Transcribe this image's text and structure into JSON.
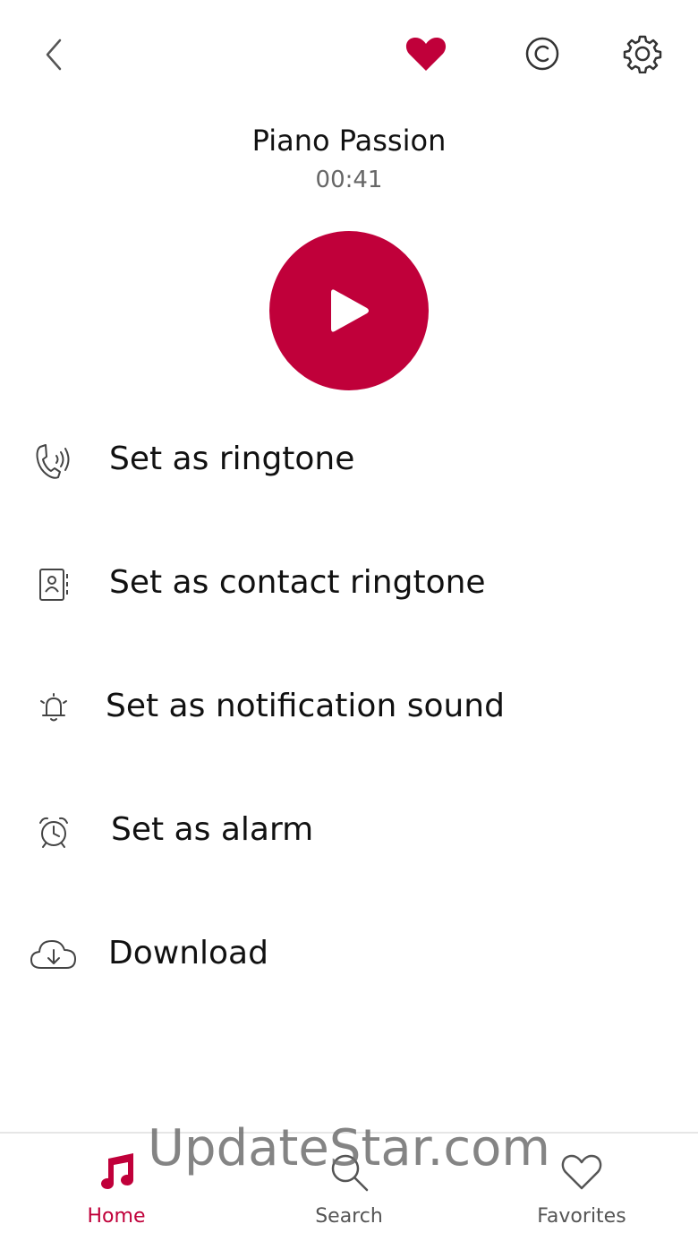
{
  "colors": {
    "accent": "#c0003a",
    "text": "#111111",
    "muted": "#666666"
  },
  "header": {
    "back_icon": "chevron-left-icon",
    "favorite_icon": "heart-filled-icon",
    "copyright_icon": "copyright-icon",
    "settings_icon": "gear-icon"
  },
  "track": {
    "title": "Piano Passion",
    "duration": "00:41"
  },
  "player": {
    "play_icon": "play-icon"
  },
  "actions": [
    {
      "label": "Set as ringtone",
      "icon": "phone-ringing-icon"
    },
    {
      "label": "Set as contact ringtone",
      "icon": "contact-card-icon"
    },
    {
      "label": "Set as notification sound",
      "icon": "bell-icon"
    },
    {
      "label": "Set as alarm",
      "icon": "alarm-clock-icon"
    },
    {
      "label": "Download",
      "icon": "cloud-download-icon"
    }
  ],
  "nav": {
    "items": [
      {
        "label": "Home",
        "icon": "music-note-icon",
        "active": true
      },
      {
        "label": "Search",
        "icon": "search-icon",
        "active": false
      },
      {
        "label": "Favorites",
        "icon": "heart-outline-icon",
        "active": false
      }
    ]
  },
  "watermark": "UpdateStar.com"
}
